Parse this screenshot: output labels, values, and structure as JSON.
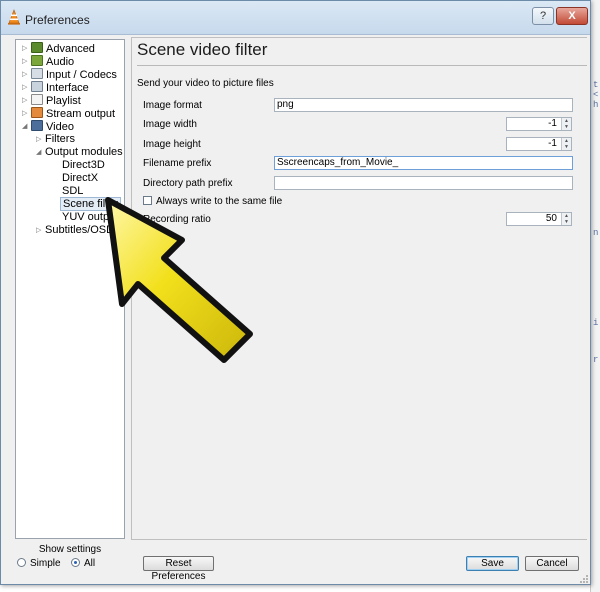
{
  "window": {
    "title": "Preferences",
    "help_label": "?",
    "close_label": "X"
  },
  "tree": {
    "items": [
      {
        "label": "Advanced",
        "icon": "advanced-icon",
        "has_arrow": true
      },
      {
        "label": "Audio",
        "icon": "audio-icon",
        "has_arrow": true
      },
      {
        "label": "Input / Codecs",
        "icon": "input-codecs-icon",
        "has_arrow": true
      },
      {
        "label": "Interface",
        "icon": "interface-icon",
        "has_arrow": true
      },
      {
        "label": "Playlist",
        "icon": "playlist-icon",
        "has_arrow": true
      },
      {
        "label": "Stream output",
        "icon": "stream-output-icon",
        "has_arrow": true
      },
      {
        "label": "Video",
        "icon": "video-icon",
        "has_arrow": true
      },
      {
        "label": "Filters",
        "has_arrow": true
      },
      {
        "label": "Output modules",
        "has_arrow": true
      },
      {
        "label": "Direct3D"
      },
      {
        "label": "DirectX"
      },
      {
        "label": "SDL"
      },
      {
        "label": "Scene filter",
        "selected": true
      },
      {
        "label": "YUV output"
      },
      {
        "label": "Subtitles/OSD",
        "has_arrow": true
      }
    ]
  },
  "show_settings": {
    "title": "Show settings",
    "options": [
      "Simple",
      "All"
    ],
    "selected": "All"
  },
  "panel": {
    "title": "Scene video filter",
    "description": "Send your video to picture files",
    "fields": {
      "image_format": {
        "label": "Image format",
        "value": "png"
      },
      "image_width": {
        "label": "Image width",
        "value": "-1"
      },
      "image_height": {
        "label": "Image height",
        "value": "-1"
      },
      "filename_prefix": {
        "label": "Filename prefix",
        "value": "Sscreencaps_from_Movie_"
      },
      "directory_path_prefix": {
        "label": "Directory path prefix",
        "value": ""
      },
      "always_write": {
        "label": "Always write to the same file",
        "checked": false
      },
      "recording_ratio": {
        "label": "Recording ratio",
        "value": "50"
      }
    }
  },
  "buttons": {
    "reset": "Reset Preferences",
    "save": "Save",
    "cancel": "Cancel"
  },
  "colors": {
    "accent_arrow": "#f2e01c",
    "selection": "#e4ecf6",
    "title_bar": "#c6d9ec"
  }
}
